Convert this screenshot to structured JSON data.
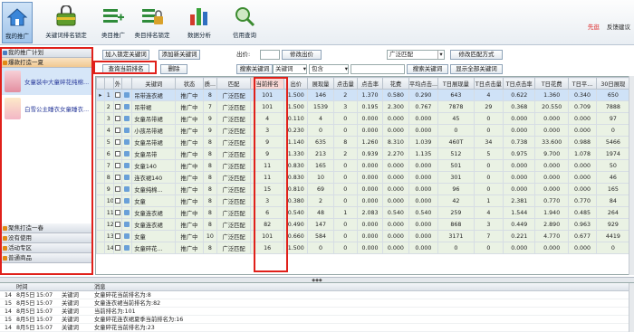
{
  "toolbar": {
    "buttons": [
      {
        "label": "我的推广",
        "icon": "home-icon"
      },
      {
        "label": "关键词排名锁定",
        "icon": "lock-icon"
      },
      {
        "label": "类目推广",
        "icon": "category-add-icon"
      },
      {
        "label": "类目排名锁定",
        "icon": "category-lock-icon"
      },
      {
        "label": "数据分析",
        "icon": "bar-chart-icon"
      },
      {
        "label": "信用查询",
        "icon": "magnifier-icon"
      }
    ],
    "link_1": "先逛",
    "link_2": "反馈建议"
  },
  "sidebar": {
    "header": "我的推广计划",
    "group_1": "爆款打造一夏",
    "items": [
      {
        "label": "女童装中大童碎花纯棉..."
      },
      {
        "label": "白雪公主睡衣女童睡衣..."
      }
    ],
    "groups_bottom": [
      "聚焦打造一春",
      "没有使用",
      "活动专区",
      "普通商品"
    ]
  },
  "controls": {
    "btn_add_keyword": "加入锁定关键词",
    "btn_add_new_keyword": "添加新关键词",
    "bid_label": "出价:",
    "btn_modify_bid": "修改出价",
    "match_value": "广泛匹配",
    "btn_modify_match": "修改匹配方式",
    "btn_query_rank": "查询当前排名",
    "btn_delete": "删除",
    "search_label": "搜索关键词",
    "search_field": "关键词",
    "search_op": "包含",
    "btn_search": "搜索关键词",
    "btn_show_all": "显示全部关键词"
  },
  "grid": {
    "columns": [
      "",
      "",
      "外",
      "",
      "关键词",
      "状态",
      "质...",
      "匹配",
      "当前排名",
      "出价",
      "展现量",
      "点击量",
      "点击率",
      "花费",
      "平均点击...",
      "T日展现量",
      "T日点击量",
      "T日点击率",
      "T日花费",
      "T日平...",
      "30日展现"
    ],
    "rows": [
      [
        "1",
        "吊带连衣裙",
        "推广中",
        "8",
        "广泛匹配",
        "101",
        "1.500",
        "146",
        "2",
        "1.370",
        "0.580",
        "0.290",
        "643",
        "4",
        "0.622",
        "1.360",
        "0.340",
        "650"
      ],
      [
        "2",
        "吊带裙",
        "推广中",
        "7",
        "广泛匹配",
        "101",
        "1.500",
        "1539",
        "3",
        "0.195",
        "2.300",
        "0.767",
        "7878",
        "29",
        "0.368",
        "20.550",
        "0.709",
        "7888"
      ],
      [
        "3",
        "女童吊带裙",
        "推广中",
        "9",
        "广泛匹配",
        "4",
        "0.110",
        "4",
        "0",
        "0.000",
        "0.000",
        "0.000",
        "45",
        "0",
        "0.000",
        "0.000",
        "0.000",
        "97"
      ],
      [
        "4",
        "小孩吊带裙",
        "推广中",
        "9",
        "广泛匹配",
        "3",
        "0.230",
        "0",
        "0",
        "0.000",
        "0.000",
        "0.000",
        "0",
        "0",
        "0.000",
        "0.000",
        "0.000",
        "0"
      ],
      [
        "5",
        "女童吊带裙",
        "推广中",
        "8",
        "广泛匹配",
        "9",
        "1.140",
        "635",
        "8",
        "1.260",
        "8.310",
        "1.039",
        "460T",
        "34",
        "0.738",
        "33.600",
        "0.988",
        "5466"
      ],
      [
        "6",
        "女童吊带",
        "推广中",
        "8",
        "广泛匹配",
        "9",
        "1.330",
        "213",
        "2",
        "0.939",
        "2.270",
        "1.135",
        "512",
        "5",
        "0.975",
        "9.700",
        "1.078",
        "1974"
      ],
      [
        "7",
        "女童140",
        "推广中",
        "8",
        "广泛匹配",
        "11",
        "0.830",
        "165",
        "0",
        "0.000",
        "0.000",
        "0.000",
        "501",
        "0",
        "0.000",
        "0.000",
        "0.000",
        "50"
      ],
      [
        "8",
        "连衣裙140",
        "推广中",
        "8",
        "广泛匹配",
        "11",
        "0.830",
        "10",
        "0",
        "0.000",
        "0.000",
        "0.000",
        "301",
        "0",
        "0.000",
        "0.000",
        "0.000",
        "46"
      ],
      [
        "9",
        "女童纯棉...",
        "推广中",
        "8",
        "广泛匹配",
        "15",
        "0.810",
        "69",
        "0",
        "0.000",
        "0.000",
        "0.000",
        "96",
        "0",
        "0.000",
        "0.000",
        "0.000",
        "165"
      ],
      [
        "10",
        "女童",
        "推广中",
        "8",
        "广泛匹配",
        "3",
        "0.380",
        "2",
        "0",
        "0.000",
        "0.000",
        "0.000",
        "42",
        "1",
        "2.381",
        "0.770",
        "0.770",
        "84"
      ],
      [
        "11",
        "女童连衣裙",
        "推广中",
        "8",
        "广泛匹配",
        "6",
        "0.540",
        "48",
        "1",
        "2.083",
        "0.540",
        "0.540",
        "259",
        "4",
        "1.544",
        "1.940",
        "0.485",
        "264"
      ],
      [
        "12",
        "女童连衣裙",
        "推广中",
        "8",
        "广泛匹配",
        "82",
        "0.490",
        "147",
        "0",
        "0.000",
        "0.000",
        "0.000",
        "868",
        "3",
        "0.449",
        "2.890",
        "0.963",
        "929"
      ],
      [
        "13",
        "女童",
        "推广中",
        "10",
        "广泛匹配",
        "101",
        "0.660",
        "584",
        "0",
        "0.000",
        "0.000",
        "0.000",
        "3171",
        "7",
        "0.221",
        "4.770",
        "0.677",
        "4419"
      ],
      [
        "14",
        "女童碎花...",
        "推广中",
        "8",
        "广泛匹配",
        "16",
        "1.500",
        "0",
        "0",
        "0.000",
        "0.000",
        "0.000",
        "0",
        "0",
        "0.000",
        "0.000",
        "0.000",
        "0"
      ]
    ]
  },
  "log": {
    "col_time": "时间",
    "col_msg": "消息",
    "rows": [
      {
        "idx": "14",
        "date": "8月5日",
        "time": "15:07",
        "type": "关键词",
        "msg": "女童碎花当前排名为:8"
      },
      {
        "idx": "15",
        "date": "8月5日",
        "time": "15:07",
        "type": "关键词",
        "msg": "女童连衣裙当前排名为:82"
      },
      {
        "idx": "14",
        "date": "8月5日",
        "time": "15:07",
        "type": "关键词",
        "msg": "当前排名为:101"
      },
      {
        "idx": "15",
        "date": "8月5日",
        "time": "15:07",
        "type": "关键词",
        "msg": "女童碎花连衣裙夏季当前排名为:16"
      },
      {
        "idx": "14",
        "date": "8月5日",
        "time": "15:07",
        "type": "关键词",
        "msg": "女童碎花当前排名为:23"
      }
    ]
  },
  "colors": {
    "accent": "#e0201a",
    "row_bg": "#eaf2e4",
    "selected_row": "#cfe2f7"
  }
}
